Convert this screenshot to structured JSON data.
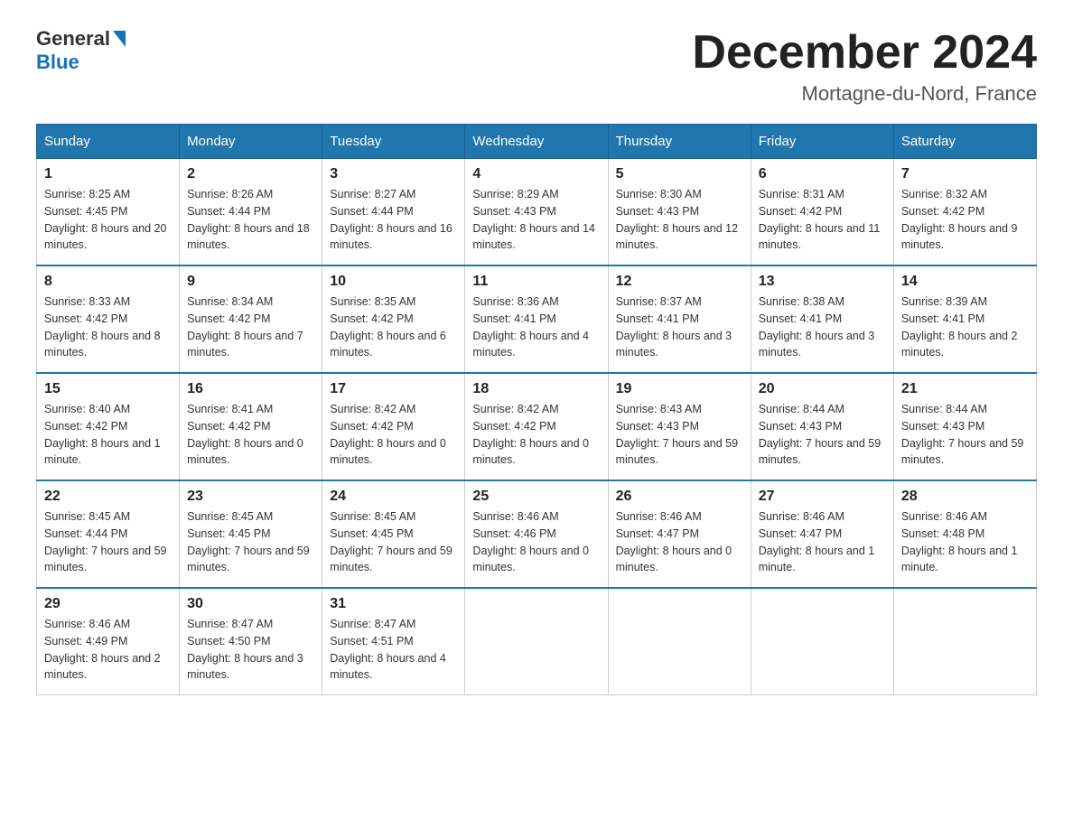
{
  "header": {
    "logo_general": "General",
    "logo_blue": "Blue",
    "month_title": "December 2024",
    "location": "Mortagne-du-Nord, France"
  },
  "weekdays": [
    "Sunday",
    "Monday",
    "Tuesday",
    "Wednesday",
    "Thursday",
    "Friday",
    "Saturday"
  ],
  "weeks": [
    [
      {
        "day": "1",
        "sunrise": "8:25 AM",
        "sunset": "4:45 PM",
        "daylight": "8 hours and 20 minutes."
      },
      {
        "day": "2",
        "sunrise": "8:26 AM",
        "sunset": "4:44 PM",
        "daylight": "8 hours and 18 minutes."
      },
      {
        "day": "3",
        "sunrise": "8:27 AM",
        "sunset": "4:44 PM",
        "daylight": "8 hours and 16 minutes."
      },
      {
        "day": "4",
        "sunrise": "8:29 AM",
        "sunset": "4:43 PM",
        "daylight": "8 hours and 14 minutes."
      },
      {
        "day": "5",
        "sunrise": "8:30 AM",
        "sunset": "4:43 PM",
        "daylight": "8 hours and 12 minutes."
      },
      {
        "day": "6",
        "sunrise": "8:31 AM",
        "sunset": "4:42 PM",
        "daylight": "8 hours and 11 minutes."
      },
      {
        "day": "7",
        "sunrise": "8:32 AM",
        "sunset": "4:42 PM",
        "daylight": "8 hours and 9 minutes."
      }
    ],
    [
      {
        "day": "8",
        "sunrise": "8:33 AM",
        "sunset": "4:42 PM",
        "daylight": "8 hours and 8 minutes."
      },
      {
        "day": "9",
        "sunrise": "8:34 AM",
        "sunset": "4:42 PM",
        "daylight": "8 hours and 7 minutes."
      },
      {
        "day": "10",
        "sunrise": "8:35 AM",
        "sunset": "4:42 PM",
        "daylight": "8 hours and 6 minutes."
      },
      {
        "day": "11",
        "sunrise": "8:36 AM",
        "sunset": "4:41 PM",
        "daylight": "8 hours and 4 minutes."
      },
      {
        "day": "12",
        "sunrise": "8:37 AM",
        "sunset": "4:41 PM",
        "daylight": "8 hours and 3 minutes."
      },
      {
        "day": "13",
        "sunrise": "8:38 AM",
        "sunset": "4:41 PM",
        "daylight": "8 hours and 3 minutes."
      },
      {
        "day": "14",
        "sunrise": "8:39 AM",
        "sunset": "4:41 PM",
        "daylight": "8 hours and 2 minutes."
      }
    ],
    [
      {
        "day": "15",
        "sunrise": "8:40 AM",
        "sunset": "4:42 PM",
        "daylight": "8 hours and 1 minute."
      },
      {
        "day": "16",
        "sunrise": "8:41 AM",
        "sunset": "4:42 PM",
        "daylight": "8 hours and 0 minutes."
      },
      {
        "day": "17",
        "sunrise": "8:42 AM",
        "sunset": "4:42 PM",
        "daylight": "8 hours and 0 minutes."
      },
      {
        "day": "18",
        "sunrise": "8:42 AM",
        "sunset": "4:42 PM",
        "daylight": "8 hours and 0 minutes."
      },
      {
        "day": "19",
        "sunrise": "8:43 AM",
        "sunset": "4:43 PM",
        "daylight": "7 hours and 59 minutes."
      },
      {
        "day": "20",
        "sunrise": "8:44 AM",
        "sunset": "4:43 PM",
        "daylight": "7 hours and 59 minutes."
      },
      {
        "day": "21",
        "sunrise": "8:44 AM",
        "sunset": "4:43 PM",
        "daylight": "7 hours and 59 minutes."
      }
    ],
    [
      {
        "day": "22",
        "sunrise": "8:45 AM",
        "sunset": "4:44 PM",
        "daylight": "7 hours and 59 minutes."
      },
      {
        "day": "23",
        "sunrise": "8:45 AM",
        "sunset": "4:45 PM",
        "daylight": "7 hours and 59 minutes."
      },
      {
        "day": "24",
        "sunrise": "8:45 AM",
        "sunset": "4:45 PM",
        "daylight": "7 hours and 59 minutes."
      },
      {
        "day": "25",
        "sunrise": "8:46 AM",
        "sunset": "4:46 PM",
        "daylight": "8 hours and 0 minutes."
      },
      {
        "day": "26",
        "sunrise": "8:46 AM",
        "sunset": "4:47 PM",
        "daylight": "8 hours and 0 minutes."
      },
      {
        "day": "27",
        "sunrise": "8:46 AM",
        "sunset": "4:47 PM",
        "daylight": "8 hours and 1 minute."
      },
      {
        "day": "28",
        "sunrise": "8:46 AM",
        "sunset": "4:48 PM",
        "daylight": "8 hours and 1 minute."
      }
    ],
    [
      {
        "day": "29",
        "sunrise": "8:46 AM",
        "sunset": "4:49 PM",
        "daylight": "8 hours and 2 minutes."
      },
      {
        "day": "30",
        "sunrise": "8:47 AM",
        "sunset": "4:50 PM",
        "daylight": "8 hours and 3 minutes."
      },
      {
        "day": "31",
        "sunrise": "8:47 AM",
        "sunset": "4:51 PM",
        "daylight": "8 hours and 4 minutes."
      },
      null,
      null,
      null,
      null
    ]
  ]
}
